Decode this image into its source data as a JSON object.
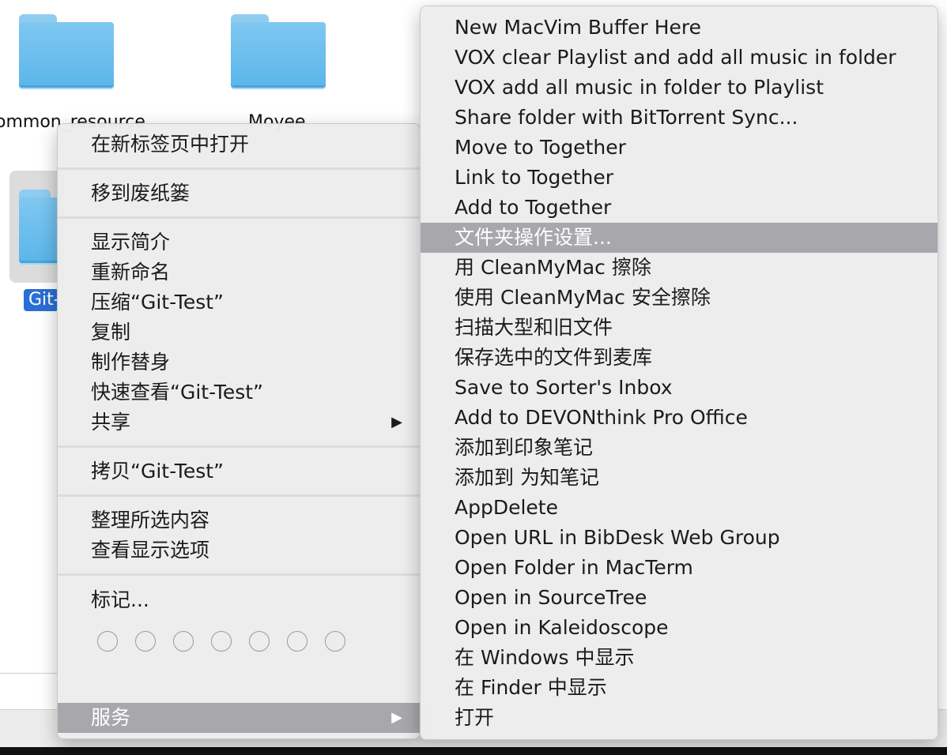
{
  "background": {
    "folder_labels": [
      "ommon_resource",
      "Moyee"
    ],
    "selected_label": "Git-"
  },
  "context_menu": {
    "items": [
      {
        "label": "在新标签页中打开"
      },
      {
        "label": "移到废纸篓"
      },
      {
        "label": "显示简介"
      },
      {
        "label": "重新命名"
      },
      {
        "label": "压缩“Git-Test”"
      },
      {
        "label": "复制"
      },
      {
        "label": "制作替身"
      },
      {
        "label": "快速查看“Git-Test”"
      },
      {
        "label": "共享",
        "submenu": "▶"
      },
      {
        "label": "拷贝“Git-Test”"
      },
      {
        "label": "整理所选内容"
      },
      {
        "label": "查看显示选项"
      },
      {
        "label": "标记..."
      },
      {
        "label": "服务",
        "submenu": "▶",
        "highlighted": true
      }
    ],
    "tag_colors": [
      "empty",
      "empty",
      "empty",
      "empty",
      "empty",
      "empty",
      "empty"
    ]
  },
  "services_menu": {
    "items": [
      "New MacVim Buffer Here",
      "VOX clear Playlist and add all music in folder",
      "VOX add all music in folder to Playlist",
      "Share folder with BitTorrent Sync...",
      "Move to Together",
      "Link to Together",
      "Add to Together",
      "文件夹操作设置...",
      "用 CleanMyMac 擦除",
      "使用 CleanMyMac 安全擦除",
      "扫描大型和旧文件",
      "保存选中的文件到麦库",
      "Save to Sorter's Inbox",
      "Add to DEVONthink Pro Office",
      "添加到印象笔记",
      "添加到 为知笔记",
      "AppDelete",
      "Open URL in BibDesk Web Group",
      "Open Folder in MacTerm",
      "Open in SourceTree",
      "Open in Kaleidoscope",
      "在 Windows 中显示",
      "在 Finder 中显示",
      "打开"
    ],
    "highlighted_index": 7
  },
  "colors": {
    "highlight": "#a8a8ac",
    "folder_blue": "#6cc0ee",
    "selection_blue": "#2a6fd6"
  }
}
